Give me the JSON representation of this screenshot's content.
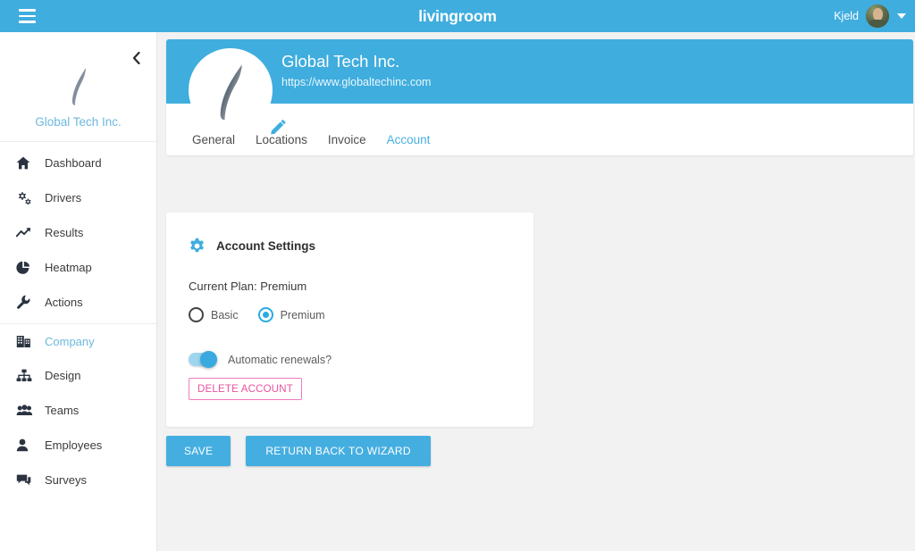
{
  "topbar": {
    "menu_icon": "hamburger-icon",
    "brand": "livingroom",
    "user_name": "Kjeld",
    "caret_icon": "chevron-down-icon"
  },
  "sidebar": {
    "collapse_icon": "chevron-left-icon",
    "company_name": "Global Tech Inc.",
    "logo_icon": "company-logo-feather",
    "items": [
      {
        "label": "Dashboard",
        "icon": "home-icon",
        "active": false,
        "separator": false
      },
      {
        "label": "Drivers",
        "icon": "gears-icon",
        "active": false,
        "separator": false
      },
      {
        "label": "Results",
        "icon": "trend-up-icon",
        "active": false,
        "separator": false
      },
      {
        "label": "Heatmap",
        "icon": "pie-chart-icon",
        "active": false,
        "separator": false
      },
      {
        "label": "Actions",
        "icon": "wrench-icon",
        "active": false,
        "separator": false
      },
      {
        "label": "Company",
        "icon": "building-icon",
        "active": true,
        "separator": true
      },
      {
        "label": "Design",
        "icon": "sitemap-icon",
        "active": false,
        "separator": false
      },
      {
        "label": "Teams",
        "icon": "users-icon",
        "active": false,
        "separator": false
      },
      {
        "label": "Employees",
        "icon": "user-icon",
        "active": false,
        "separator": false
      },
      {
        "label": "Surveys",
        "icon": "comments-icon",
        "active": false,
        "separator": false
      }
    ]
  },
  "profile": {
    "title": "Global Tech Inc.",
    "url": "https://www.globaltechinc.com",
    "edit_icon": "pencil-icon",
    "avatar_icon": "company-logo-feather",
    "tabs": [
      {
        "label": "General",
        "active": false
      },
      {
        "label": "Locations",
        "active": false
      },
      {
        "label": "Invoice",
        "active": false
      },
      {
        "label": "Account",
        "active": true
      }
    ]
  },
  "account_settings": {
    "icon": "gear-icon",
    "title": "Account Settings",
    "current_plan_text": "Current Plan: Premium",
    "plan_options": [
      {
        "label": "Basic",
        "checked": false
      },
      {
        "label": "Premium",
        "checked": true
      }
    ],
    "renewals_label": "Automatic renewals?",
    "renewals_on": true,
    "delete_label": "DELETE ACCOUNT"
  },
  "actions": {
    "save_label": "SAVE",
    "wizard_label": "RETURN BACK TO WIZARD"
  },
  "colors": {
    "brand_blue": "#3fadde",
    "link_blue": "#6cb8de",
    "accent_blue": "#29abe2",
    "danger_pink": "#e8519f",
    "page_bg": "#f2f2f2",
    "panel_white": "#ffffff"
  }
}
